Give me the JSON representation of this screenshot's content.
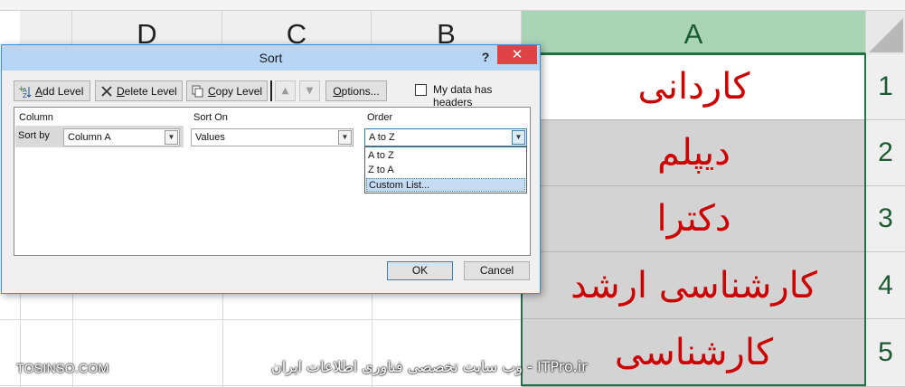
{
  "sheet": {
    "columns": [
      {
        "label": "D"
      },
      {
        "label": "C"
      },
      {
        "label": "B"
      },
      {
        "label": "A"
      }
    ],
    "rows": [
      {
        "number": "1",
        "value": "کاردانی"
      },
      {
        "number": "2",
        "value": "دیپلم"
      },
      {
        "number": "3",
        "value": "دکترا"
      },
      {
        "number": "4",
        "value": "کارشناسی ارشد"
      },
      {
        "number": "5",
        "value": "کارشناسی"
      }
    ],
    "selection_color": "#217346",
    "value_color": "#cc0000"
  },
  "dialog": {
    "title": "Sort",
    "help": "?",
    "close": "✕",
    "toolbar": {
      "add_level": {
        "pre": "",
        "key": "A",
        "post": "dd Level"
      },
      "delete_level": {
        "pre": "",
        "key": "D",
        "post": "elete Level"
      },
      "copy_level": {
        "pre": "",
        "key": "C",
        "post": "opy Level"
      },
      "move_up": "▲",
      "move_down": "▼",
      "options": {
        "pre": "",
        "key": "O",
        "post": "ptions..."
      },
      "headers_checkbox": {
        "pre": "My data has ",
        "key": "h",
        "post": "eaders",
        "checked": false
      }
    },
    "grid": {
      "headers": {
        "column": "Column",
        "sort_on": "Sort On",
        "order": "Order"
      },
      "row": {
        "label": "Sort by",
        "column": "Column A",
        "sort_on": "Values",
        "order": "A to Z"
      },
      "order_options": [
        "A to Z",
        "Z to A",
        "Custom List..."
      ],
      "highlighted_option": "Custom List..."
    },
    "ok": "OK",
    "cancel": "Cancel"
  },
  "watermark": {
    "left": "TOSINSO.COM",
    "right": "ITPro.ir - وب سایت تخصصی فناوری اطلاعات ایران"
  }
}
